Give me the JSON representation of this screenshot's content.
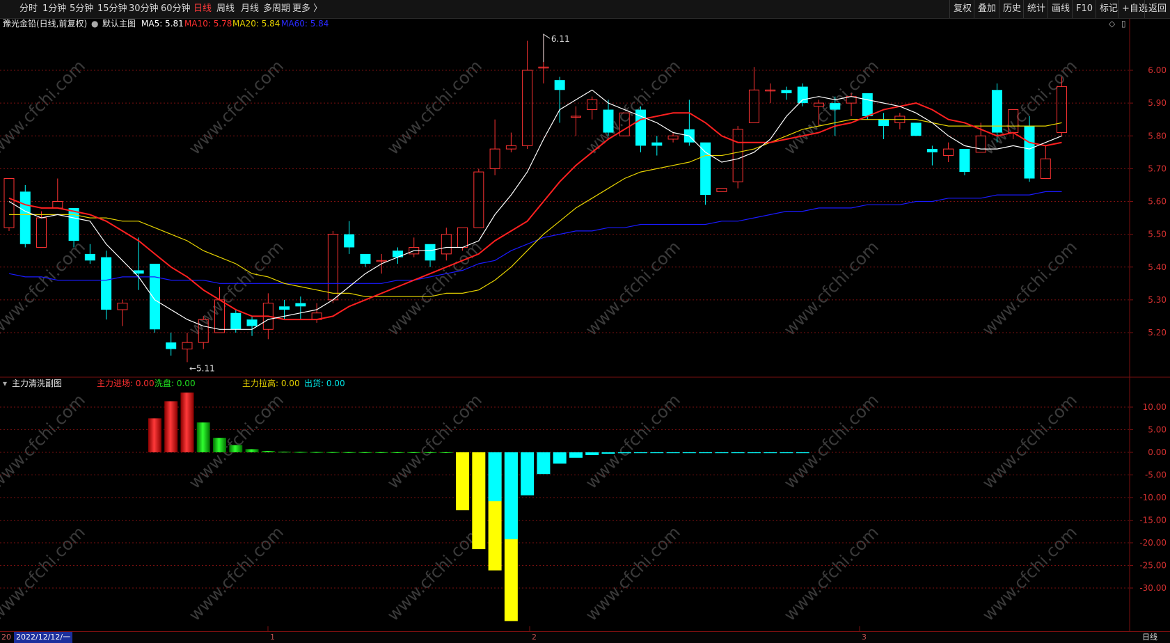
{
  "toolbar": {
    "left": [
      "分时",
      "1分钟",
      "5分钟",
      "15分钟",
      "30分钟",
      "60分钟",
      "日线",
      "周线",
      "月线",
      "多周期",
      "更多 〉"
    ],
    "active": "日线",
    "right": [
      "复权",
      "叠加",
      "历史",
      "统计",
      "画线",
      "F10",
      "标记",
      "+自选",
      "返回"
    ]
  },
  "main_info": {
    "stock": "豫光金铅(日线,前复权)",
    "mainchart": "默认主图",
    "ma5": "MA5: 5.81",
    "ma10": "MA10: 5.78",
    "ma20": "MA20: 5.84",
    "ma60": "MA60: 5.84"
  },
  "sub_info": {
    "title": "主力清洗副图",
    "s1": "主力进场: 0.00",
    "s2": "洗盘: 0.00",
    "s3": "主力拉高: 0.00",
    "s4": "出货: 0.00"
  },
  "annotations": {
    "high": "6.11",
    "low": "←5.11"
  },
  "bottom": {
    "lead": "20",
    "date": "2022/12/12/一",
    "month_marks": [
      "1",
      "2",
      "3"
    ],
    "period": "日线"
  },
  "colors": {
    "up": "#ff3333",
    "down": "#00ffff",
    "ma5": "#ffffff",
    "ma10": "#ff2020",
    "ma20": "#e6d200",
    "ma60": "#1a1aff",
    "sub_red": "#e01010",
    "sub_green": "#00d000",
    "sub_yellow": "#ffff00",
    "sub_cyan": "#00ffff",
    "grid": "#7a1010"
  },
  "chart_data": [
    {
      "type": "candlestick",
      "title": "豫光金铅(日线,前复权)",
      "y_ticks": [
        "6.00",
        "5.90",
        "5.80",
        "5.70",
        "5.60",
        "5.50",
        "5.40",
        "5.30",
        "5.20"
      ],
      "ylim": [
        5.0,
        6.2
      ],
      "candles": [
        {
          "o": 5.52,
          "c": 5.67,
          "h": 5.67,
          "l": 5.51
        },
        {
          "o": 5.63,
          "c": 5.47,
          "h": 5.65,
          "l": 5.46
        },
        {
          "o": 5.46,
          "c": 5.55,
          "h": 5.57,
          "l": 5.46
        },
        {
          "o": 5.58,
          "c": 5.6,
          "h": 5.67,
          "l": 5.58
        },
        {
          "o": 5.58,
          "c": 5.48,
          "h": 5.58,
          "l": 5.46
        },
        {
          "o": 5.44,
          "c": 5.42,
          "h": 5.47,
          "l": 5.41
        },
        {
          "o": 5.43,
          "c": 5.27,
          "h": 5.45,
          "l": 5.24
        },
        {
          "o": 5.27,
          "c": 5.29,
          "h": 5.3,
          "l": 5.22
        },
        {
          "o": 5.39,
          "c": 5.38,
          "h": 5.49,
          "l": 5.33
        },
        {
          "o": 5.41,
          "c": 5.21,
          "h": 5.41,
          "l": 5.2
        },
        {
          "o": 5.17,
          "c": 5.15,
          "h": 5.2,
          "l": 5.13
        },
        {
          "o": 5.15,
          "c": 5.17,
          "h": 5.2,
          "l": 5.11
        },
        {
          "o": 5.17,
          "c": 5.24,
          "h": 5.25,
          "l": 5.15
        },
        {
          "o": 5.2,
          "c": 5.3,
          "h": 5.34,
          "l": 5.2
        },
        {
          "o": 5.26,
          "c": 5.21,
          "h": 5.27,
          "l": 5.2
        },
        {
          "o": 5.24,
          "c": 5.22,
          "h": 5.25,
          "l": 5.19
        },
        {
          "o": 5.21,
          "c": 5.29,
          "h": 5.32,
          "l": 5.18
        },
        {
          "o": 5.28,
          "c": 5.27,
          "h": 5.3,
          "l": 5.24
        },
        {
          "o": 5.29,
          "c": 5.28,
          "h": 5.31,
          "l": 5.24
        },
        {
          "o": 5.24,
          "c": 5.26,
          "h": 5.29,
          "l": 5.23
        },
        {
          "o": 5.3,
          "c": 5.5,
          "h": 5.51,
          "l": 5.29
        },
        {
          "o": 5.5,
          "c": 5.46,
          "h": 5.54,
          "l": 5.44
        },
        {
          "o": 5.44,
          "c": 5.41,
          "h": 5.44,
          "l": 5.4
        },
        {
          "o": 5.42,
          "c": 5.42,
          "h": 5.44,
          "l": 5.38
        },
        {
          "o": 5.45,
          "c": 5.43,
          "h": 5.46,
          "l": 5.41
        },
        {
          "o": 5.44,
          "c": 5.46,
          "h": 5.49,
          "l": 5.43
        },
        {
          "o": 5.47,
          "c": 5.42,
          "h": 5.47,
          "l": 5.4
        },
        {
          "o": 5.44,
          "c": 5.5,
          "h": 5.52,
          "l": 5.42
        },
        {
          "o": 5.46,
          "c": 5.52,
          "h": 5.52,
          "l": 5.45
        },
        {
          "o": 5.52,
          "c": 5.69,
          "h": 5.7,
          "l": 5.52
        },
        {
          "o": 5.7,
          "c": 5.76,
          "h": 5.85,
          "l": 5.68
        },
        {
          "o": 5.76,
          "c": 5.77,
          "h": 5.81,
          "l": 5.75
        },
        {
          "o": 5.77,
          "c": 6.0,
          "h": 6.09,
          "l": 5.76
        },
        {
          "o": 6.01,
          "c": 6.01,
          "h": 6.11,
          "l": 5.96
        },
        {
          "o": 5.97,
          "c": 5.94,
          "h": 5.98,
          "l": 5.84
        },
        {
          "o": 5.86,
          "c": 5.86,
          "h": 5.89,
          "l": 5.8
        },
        {
          "o": 5.88,
          "c": 5.91,
          "h": 5.92,
          "l": 5.85
        },
        {
          "o": 5.88,
          "c": 5.81,
          "h": 5.91,
          "l": 5.8
        },
        {
          "o": 5.8,
          "c": 5.87,
          "h": 5.87,
          "l": 5.8
        },
        {
          "o": 5.88,
          "c": 5.77,
          "h": 5.89,
          "l": 5.75
        },
        {
          "o": 5.78,
          "c": 5.77,
          "h": 5.8,
          "l": 5.74
        },
        {
          "o": 5.79,
          "c": 5.8,
          "h": 5.81,
          "l": 5.78
        },
        {
          "o": 5.82,
          "c": 5.78,
          "h": 5.91,
          "l": 5.77
        },
        {
          "o": 5.78,
          "c": 5.62,
          "h": 5.78,
          "l": 5.59
        },
        {
          "o": 5.63,
          "c": 5.64,
          "h": 5.64,
          "l": 5.63
        },
        {
          "o": 5.66,
          "c": 5.82,
          "h": 5.83,
          "l": 5.64
        },
        {
          "o": 5.84,
          "c": 5.94,
          "h": 6.01,
          "l": 5.84
        },
        {
          "o": 5.94,
          "c": 5.94,
          "h": 5.96,
          "l": 5.9
        },
        {
          "o": 5.94,
          "c": 5.93,
          "h": 5.95,
          "l": 5.91
        },
        {
          "o": 5.95,
          "c": 5.9,
          "h": 5.96,
          "l": 5.89
        },
        {
          "o": 5.89,
          "c": 5.9,
          "h": 5.91,
          "l": 5.83
        },
        {
          "o": 5.9,
          "c": 5.88,
          "h": 5.92,
          "l": 5.8
        },
        {
          "o": 5.9,
          "c": 5.92,
          "h": 5.93,
          "l": 5.86
        },
        {
          "o": 5.93,
          "c": 5.86,
          "h": 5.93,
          "l": 5.85
        },
        {
          "o": 5.85,
          "c": 5.83,
          "h": 5.87,
          "l": 5.79
        },
        {
          "o": 5.84,
          "c": 5.86,
          "h": 5.87,
          "l": 5.82
        },
        {
          "o": 5.84,
          "c": 5.8,
          "h": 5.84,
          "l": 5.8
        },
        {
          "o": 5.76,
          "c": 5.75,
          "h": 5.77,
          "l": 5.71
        },
        {
          "o": 5.74,
          "c": 5.76,
          "h": 5.78,
          "l": 5.72
        },
        {
          "o": 5.76,
          "c": 5.69,
          "h": 5.76,
          "l": 5.68
        },
        {
          "o": 5.75,
          "c": 5.8,
          "h": 5.84,
          "l": 5.75
        },
        {
          "o": 5.94,
          "c": 5.81,
          "h": 5.96,
          "l": 5.78
        },
        {
          "o": 5.81,
          "c": 5.88,
          "h": 5.88,
          "l": 5.79
        },
        {
          "o": 5.83,
          "c": 5.67,
          "h": 5.86,
          "l": 5.66
        },
        {
          "o": 5.67,
          "c": 5.73,
          "h": 5.77,
          "l": 5.67
        },
        {
          "o": 5.81,
          "c": 5.95,
          "h": 5.98,
          "l": 5.8
        }
      ],
      "ma5": [
        5.6,
        5.57,
        5.55,
        5.56,
        5.55,
        5.54,
        5.47,
        5.42,
        5.37,
        5.3,
        5.27,
        5.24,
        5.22,
        5.21,
        5.21,
        5.21,
        5.24,
        5.25,
        5.26,
        5.27,
        5.3,
        5.34,
        5.38,
        5.41,
        5.43,
        5.45,
        5.45,
        5.46,
        5.46,
        5.48,
        5.56,
        5.62,
        5.69,
        5.79,
        5.88,
        5.91,
        5.94,
        5.9,
        5.88,
        5.86,
        5.84,
        5.81,
        5.8,
        5.75,
        5.72,
        5.73,
        5.75,
        5.79,
        5.86,
        5.91,
        5.92,
        5.91,
        5.92,
        5.91,
        5.9,
        5.89,
        5.87,
        5.84,
        5.8,
        5.77,
        5.76,
        5.76,
        5.77,
        5.76,
        5.78,
        5.8
      ],
      "ma10": [
        5.61,
        5.59,
        5.58,
        5.58,
        5.57,
        5.56,
        5.54,
        5.51,
        5.48,
        5.44,
        5.4,
        5.37,
        5.33,
        5.3,
        5.27,
        5.25,
        5.25,
        5.24,
        5.24,
        5.24,
        5.25,
        5.28,
        5.3,
        5.32,
        5.34,
        5.36,
        5.38,
        5.4,
        5.42,
        5.44,
        5.48,
        5.51,
        5.54,
        5.6,
        5.66,
        5.71,
        5.75,
        5.79,
        5.82,
        5.85,
        5.86,
        5.87,
        5.87,
        5.84,
        5.8,
        5.78,
        5.78,
        5.78,
        5.79,
        5.8,
        5.81,
        5.83,
        5.84,
        5.86,
        5.88,
        5.89,
        5.9,
        5.88,
        5.85,
        5.84,
        5.82,
        5.8,
        5.81,
        5.78,
        5.77,
        5.78
      ],
      "ma20": [
        5.56,
        5.56,
        5.56,
        5.56,
        5.56,
        5.55,
        5.55,
        5.54,
        5.54,
        5.52,
        5.5,
        5.48,
        5.45,
        5.43,
        5.41,
        5.38,
        5.37,
        5.35,
        5.34,
        5.33,
        5.32,
        5.32,
        5.31,
        5.31,
        5.31,
        5.31,
        5.31,
        5.32,
        5.32,
        5.33,
        5.36,
        5.4,
        5.45,
        5.5,
        5.54,
        5.58,
        5.61,
        5.64,
        5.67,
        5.69,
        5.7,
        5.71,
        5.72,
        5.74,
        5.74,
        5.75,
        5.76,
        5.78,
        5.8,
        5.82,
        5.83,
        5.84,
        5.85,
        5.85,
        5.85,
        5.85,
        5.85,
        5.84,
        5.83,
        5.83,
        5.83,
        5.83,
        5.83,
        5.83,
        5.83,
        5.84
      ],
      "ma60": [
        5.38,
        5.37,
        5.37,
        5.36,
        5.36,
        5.36,
        5.36,
        5.37,
        5.37,
        5.37,
        5.36,
        5.36,
        5.36,
        5.35,
        5.35,
        5.35,
        5.35,
        5.35,
        5.35,
        5.35,
        5.35,
        5.35,
        5.35,
        5.35,
        5.36,
        5.36,
        5.37,
        5.38,
        5.39,
        5.41,
        5.42,
        5.45,
        5.47,
        5.49,
        5.5,
        5.51,
        5.51,
        5.52,
        5.52,
        5.53,
        5.53,
        5.53,
        5.53,
        5.53,
        5.54,
        5.54,
        5.55,
        5.56,
        5.57,
        5.57,
        5.58,
        5.58,
        5.58,
        5.59,
        5.59,
        5.59,
        5.6,
        5.6,
        5.61,
        5.61,
        5.61,
        5.62,
        5.62,
        5.62,
        5.63,
        5.63
      ]
    },
    {
      "type": "bar",
      "title": "主力清洗副图",
      "y_ticks": [
        "10.00",
        "5.00",
        "0.00",
        "-5.00",
        "-10.00",
        "-15.00",
        "-20.00",
        "-25.00",
        "-30.00"
      ],
      "ylim": [
        -38,
        15
      ],
      "categories_index_start": 9,
      "series": [
        {
          "name": "主力进场",
          "values": [
            7.5,
            11.3,
            13.2
          ]
        },
        {
          "name": "洗盘",
          "values": [
            6.6,
            3.2,
            1.6,
            0.7,
            0.3,
            0.15,
            0.1,
            0.08,
            0.06,
            0.05,
            0.04,
            0.04,
            0.03,
            0.03,
            0.02,
            0.02,
            0.02,
            0.02,
            0.01,
            0.01
          ]
        },
        {
          "name": "主力拉高",
          "values": [
            -12.8,
            -21.4,
            -26.1,
            -37.3
          ]
        },
        {
          "name": "出货",
          "values": [
            -10.8,
            -19.2,
            -9.5,
            -4.8,
            -2.5,
            -1.2,
            -0.6,
            -0.3,
            -0.2,
            -0.1,
            -0.1,
            -0.05,
            -0.05,
            -0.04,
            -0.03,
            -0.03,
            -0.02,
            -0.02,
            -0.02,
            -0.01
          ]
        }
      ]
    }
  ],
  "watermark": "www.cfchi.com"
}
